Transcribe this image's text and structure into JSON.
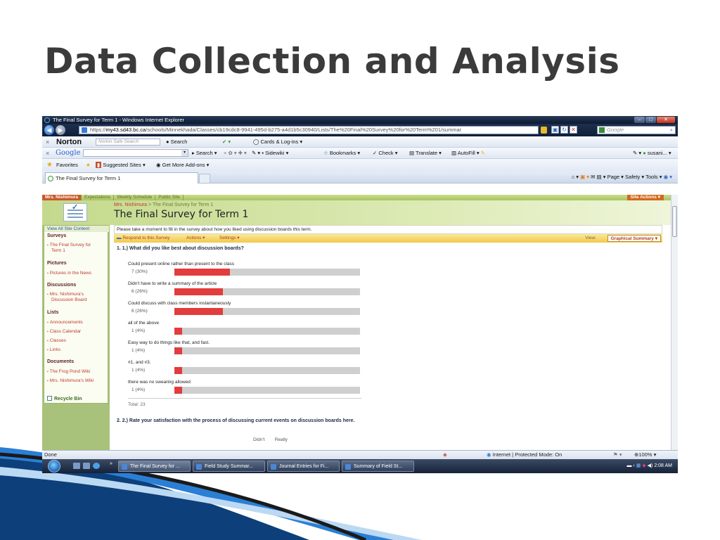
{
  "slide": {
    "title": "Data Collection and Analysis"
  },
  "browser": {
    "window_title": "The Final Survey for Term 1 - Windows Internet Explorer",
    "url_prefix": "https://",
    "url_host": "my43.sd43.bc.ca",
    "url_path": "/schools/Minnekhada/Classes/cb19cdc8-9941-495d-b275-a4d1b5c30940/Lists/The%20Final%20Survey%20for%20Term%201/summar",
    "google_box_placeholder": "Google",
    "norton": {
      "logo": "Norton",
      "placeholder": "Norton Safe Search",
      "search": "Search",
      "cards": "Cards & Log-ins"
    },
    "google_bar": {
      "logo": "Google",
      "search": "Search",
      "sidewiki": "Sidewiki",
      "bookmarks": "Bookmarks",
      "check": "Check",
      "translate": "Translate",
      "autofill": "AutoFill",
      "user": "susani..."
    },
    "favorites": {
      "label": "Favorites",
      "suggested": "Suggested Sites",
      "addons": "Get More Add-ons"
    },
    "tab_title": "The Final Survey for Term 1",
    "command_bar": {
      "page": "Page",
      "safety": "Safety",
      "tools": "Tools"
    }
  },
  "site": {
    "top_nav": [
      "Mrs. Nishimura",
      "Expectations",
      "Weekly Schedule",
      "Public Site"
    ],
    "site_actions": "Site Actions",
    "breadcrumb_root": "Mrs. Nishimura",
    "breadcrumb_sep": ">",
    "breadcrumb_page": "The Final Survey for Term 1",
    "page_title": "The Final Survey for Term 1"
  },
  "leftnav": {
    "view_all": "View All Site Content",
    "surveys": "Surveys",
    "survey_item_1": "The Final Survey for",
    "survey_item_2": "Term 1",
    "pictures": "Pictures",
    "pictures_item": "Pictures in the News",
    "discussions": "Discussions",
    "discussions_item_1": "Mrs. Nishimura's",
    "discussions_item_2": "Discussion Board",
    "lists": "Lists",
    "lists_items": [
      "Announcements",
      "Class Calendar",
      "Classes",
      "Links"
    ],
    "documents": "Documents",
    "documents_items": [
      "The Frog Pond Wiki",
      "Mrs. Nishimura's Wiki"
    ],
    "recycle": "Recycle Bin"
  },
  "survey": {
    "intro": "Please take a moment to fill in the survey about how you liked using discussion boards this term.",
    "respond": "Respond to this Survey",
    "actions": "Actions",
    "settings": "Settings",
    "view_label": "View:",
    "view_value": "Graphical Summary",
    "q1_title": "1. 1.) What did you like best about discussion boards?",
    "results": [
      {
        "label": "Could present online rather than present to the class",
        "count": "7 (30%)",
        "percent": 30
      },
      {
        "label": "Didn't have to write a summary of the article",
        "count": "6 (26%)",
        "percent": 26
      },
      {
        "label": "Could discuss with class members instantaneously",
        "count": "6 (26%)",
        "percent": 26
      },
      {
        "label": "all of the above",
        "count": "1 (4%)",
        "percent": 4
      },
      {
        "label": "Easy way to do things like that, and fast.",
        "count": "1 (4%)",
        "percent": 4
      },
      {
        "label": "#1, and #3.",
        "count": "1 (4%)",
        "percent": 4
      },
      {
        "label": "there was no swearing allowed",
        "count": "1 (4%)",
        "percent": 4
      }
    ],
    "total": "Total: 23",
    "q2_title": "2. 2.) Rate your satisfaction with the process of discussing current events on discussion boards here.",
    "q2_header": "Didn't        Really"
  },
  "status": {
    "left": "Done",
    "zone": "Internet | Protected Mode: On",
    "zoom": "100%"
  },
  "taskbar": {
    "tasks": [
      "The Final Survey for ...",
      "Field Study Summar...",
      "Journal Entries for Fi...",
      "Summary of Field St..."
    ],
    "clock": "2:08 AM"
  },
  "colors": {
    "bar_fill": "#e23c3c",
    "bar_track": "#cfcfcf",
    "site_green": "#a8c27b",
    "slide_title": "#3b3b3b"
  }
}
